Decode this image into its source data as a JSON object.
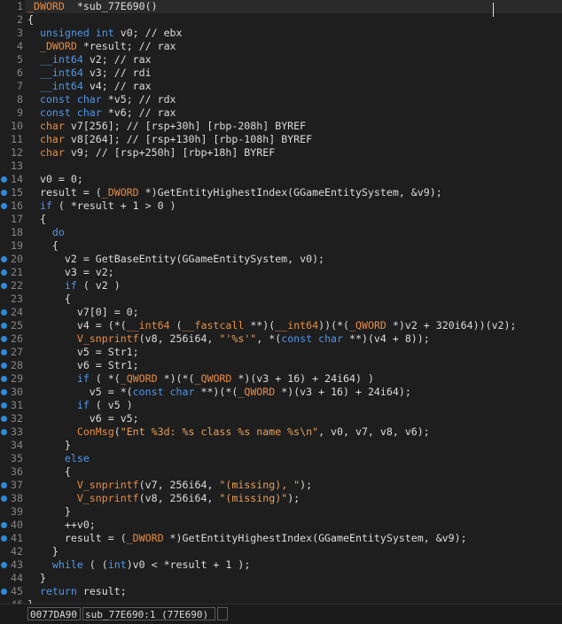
{
  "editor": {
    "lines": [
      {
        "n": "1",
        "bp": false,
        "tokens": [
          [
            "ty",
            "_DWORD"
          ],
          [
            "",
            "  *sub_77E690()"
          ]
        ]
      },
      {
        "n": "2",
        "bp": false,
        "tokens": [
          [
            "",
            "{"
          ]
        ]
      },
      {
        "n": "3",
        "bp": false,
        "tokens": [
          [
            "",
            "  "
          ],
          [
            "kw",
            "unsigned int"
          ],
          [
            "",
            " v0; // ebx"
          ]
        ]
      },
      {
        "n": "4",
        "bp": false,
        "tokens": [
          [
            "",
            "  "
          ],
          [
            "ty",
            "_DWORD"
          ],
          [
            "",
            " *result; // rax"
          ]
        ]
      },
      {
        "n": "5",
        "bp": false,
        "tokens": [
          [
            "",
            "  "
          ],
          [
            "kw",
            "__int64"
          ],
          [
            "",
            " v2; // rax"
          ]
        ]
      },
      {
        "n": "6",
        "bp": false,
        "tokens": [
          [
            "",
            "  "
          ],
          [
            "kw",
            "__int64"
          ],
          [
            "",
            " v3; // rdi"
          ]
        ]
      },
      {
        "n": "7",
        "bp": false,
        "tokens": [
          [
            "",
            "  "
          ],
          [
            "kw",
            "__int64"
          ],
          [
            "",
            " v4; // rax"
          ]
        ]
      },
      {
        "n": "8",
        "bp": false,
        "tokens": [
          [
            "",
            "  "
          ],
          [
            "kw",
            "const char"
          ],
          [
            "",
            " *v5; // rdx"
          ]
        ]
      },
      {
        "n": "9",
        "bp": false,
        "tokens": [
          [
            "",
            "  "
          ],
          [
            "kw",
            "const char"
          ],
          [
            "",
            " *v6; // rax"
          ]
        ]
      },
      {
        "n": "10",
        "bp": false,
        "tokens": [
          [
            "",
            "  "
          ],
          [
            "ty",
            "char"
          ],
          [
            "",
            " v7[256]; // [rsp+30h] [rbp-208h] BYREF"
          ]
        ]
      },
      {
        "n": "11",
        "bp": false,
        "tokens": [
          [
            "",
            "  "
          ],
          [
            "ty",
            "char"
          ],
          [
            "",
            " v8[264]; // [rsp+130h] [rbp-108h] BYREF"
          ]
        ]
      },
      {
        "n": "12",
        "bp": false,
        "tokens": [
          [
            "",
            "  "
          ],
          [
            "ty",
            "char"
          ],
          [
            "",
            " v9; // [rsp+250h] [rbp+18h] BYREF"
          ]
        ]
      },
      {
        "n": "13",
        "bp": false,
        "tokens": [
          [
            "",
            ""
          ]
        ]
      },
      {
        "n": "14",
        "bp": true,
        "tokens": [
          [
            "",
            "  v0 = 0;"
          ]
        ]
      },
      {
        "n": "15",
        "bp": true,
        "tokens": [
          [
            "",
            "  result = ("
          ],
          [
            "ty",
            "_DWORD"
          ],
          [
            "",
            " *)GetEntityHighestIndex(GGameEntitySystem, &v9);"
          ]
        ]
      },
      {
        "n": "16",
        "bp": true,
        "tokens": [
          [
            "",
            "  "
          ],
          [
            "kw",
            "if"
          ],
          [
            "",
            " ( *result + 1 > 0 )"
          ]
        ]
      },
      {
        "n": "17",
        "bp": false,
        "tokens": [
          [
            "",
            "  {"
          ]
        ]
      },
      {
        "n": "18",
        "bp": false,
        "tokens": [
          [
            "",
            "    "
          ],
          [
            "kw",
            "do"
          ]
        ]
      },
      {
        "n": "19",
        "bp": false,
        "tokens": [
          [
            "",
            "    {"
          ]
        ]
      },
      {
        "n": "20",
        "bp": true,
        "tokens": [
          [
            "",
            "      v2 = GetBaseEntity(GGameEntitySystem, v0);"
          ]
        ]
      },
      {
        "n": "21",
        "bp": true,
        "tokens": [
          [
            "",
            "      v3 = v2;"
          ]
        ]
      },
      {
        "n": "22",
        "bp": true,
        "tokens": [
          [
            "",
            "      "
          ],
          [
            "kw",
            "if"
          ],
          [
            "",
            " ( v2 )"
          ]
        ]
      },
      {
        "n": "23",
        "bp": false,
        "tokens": [
          [
            "",
            "      {"
          ]
        ]
      },
      {
        "n": "24",
        "bp": true,
        "tokens": [
          [
            "",
            "        v7[0] = 0;"
          ]
        ]
      },
      {
        "n": "25",
        "bp": true,
        "tokens": [
          [
            "",
            "        v4 = (*("
          ],
          [
            "ty",
            "__int64"
          ],
          [
            "",
            " ("
          ],
          [
            "ty",
            "__fastcall"
          ],
          [
            "",
            " **)("
          ],
          [
            "ty",
            "__int64"
          ],
          [
            "",
            "))(*("
          ],
          [
            "ty",
            "_QWORD"
          ],
          [
            "",
            " *)v2 + 320i64))(v2);"
          ]
        ]
      },
      {
        "n": "26",
        "bp": true,
        "tokens": [
          [
            "",
            "        "
          ],
          [
            "cg",
            "V_snprintf"
          ],
          [
            "",
            "(v8, 256i64, "
          ],
          [
            "str",
            "\"'%s'\""
          ],
          [
            "",
            ", *("
          ],
          [
            "kw",
            "const char"
          ],
          [
            "",
            " **)(v4 + 8));"
          ]
        ]
      },
      {
        "n": "27",
        "bp": true,
        "tokens": [
          [
            "",
            "        v5 = Str1;"
          ]
        ]
      },
      {
        "n": "28",
        "bp": true,
        "tokens": [
          [
            "",
            "        v6 = Str1;"
          ]
        ]
      },
      {
        "n": "29",
        "bp": true,
        "tokens": [
          [
            "",
            "        "
          ],
          [
            "kw",
            "if"
          ],
          [
            "",
            " ( *("
          ],
          [
            "ty",
            "_QWORD"
          ],
          [
            "",
            " *)(*("
          ],
          [
            "ty",
            "_QWORD"
          ],
          [
            "",
            " *)(v3 + 16) + 24i64) )"
          ]
        ]
      },
      {
        "n": "30",
        "bp": true,
        "tokens": [
          [
            "",
            "          v5 = *("
          ],
          [
            "kw",
            "const char"
          ],
          [
            "",
            " **)(*("
          ],
          [
            "ty",
            "_QWORD"
          ],
          [
            "",
            " *)(v3 + 16) + 24i64);"
          ]
        ]
      },
      {
        "n": "31",
        "bp": true,
        "tokens": [
          [
            "",
            "        "
          ],
          [
            "kw",
            "if"
          ],
          [
            "",
            " ( v5 )"
          ]
        ]
      },
      {
        "n": "32",
        "bp": true,
        "tokens": [
          [
            "",
            "          v6 = v5;"
          ]
        ]
      },
      {
        "n": "33",
        "bp": true,
        "tokens": [
          [
            "",
            "        "
          ],
          [
            "cg",
            "ConMsg"
          ],
          [
            "",
            "("
          ],
          [
            "str",
            "\"Ent %3d: %s class %s name %s\\n\""
          ],
          [
            "",
            ", v0, v7, v8, v6);"
          ]
        ]
      },
      {
        "n": "34",
        "bp": false,
        "tokens": [
          [
            "",
            "      }"
          ]
        ]
      },
      {
        "n": "35",
        "bp": false,
        "tokens": [
          [
            "",
            "      "
          ],
          [
            "kw",
            "else"
          ]
        ]
      },
      {
        "n": "36",
        "bp": false,
        "tokens": [
          [
            "",
            "      {"
          ]
        ]
      },
      {
        "n": "37",
        "bp": true,
        "tokens": [
          [
            "",
            "        "
          ],
          [
            "cg",
            "V_snprintf"
          ],
          [
            "",
            "(v7, 256i64, "
          ],
          [
            "str",
            "\"(missing), \""
          ],
          [
            "",
            ");"
          ]
        ]
      },
      {
        "n": "38",
        "bp": true,
        "tokens": [
          [
            "",
            "        "
          ],
          [
            "cg",
            "V_snprintf"
          ],
          [
            "",
            "(v8, 256i64, "
          ],
          [
            "str",
            "\"(missing)\""
          ],
          [
            "",
            ");"
          ]
        ]
      },
      {
        "n": "39",
        "bp": false,
        "tokens": [
          [
            "",
            "      }"
          ]
        ]
      },
      {
        "n": "40",
        "bp": true,
        "tokens": [
          [
            "",
            "      ++v0;"
          ]
        ]
      },
      {
        "n": "41",
        "bp": true,
        "tokens": [
          [
            "",
            "      result = ("
          ],
          [
            "ty",
            "_DWORD"
          ],
          [
            "",
            " *)GetEntityHighestIndex(GGameEntitySystem, &v9);"
          ]
        ]
      },
      {
        "n": "42",
        "bp": false,
        "tokens": [
          [
            "",
            "    }"
          ]
        ]
      },
      {
        "n": "43",
        "bp": true,
        "tokens": [
          [
            "",
            "    "
          ],
          [
            "kw",
            "while"
          ],
          [
            "",
            " ( ("
          ],
          [
            "kw",
            "int"
          ],
          [
            "",
            ")v0 < *result + 1 );"
          ]
        ]
      },
      {
        "n": "44",
        "bp": false,
        "tokens": [
          [
            "",
            "  }"
          ]
        ]
      },
      {
        "n": "45",
        "bp": true,
        "tokens": [
          [
            "",
            "  "
          ],
          [
            "kw",
            "return"
          ],
          [
            "",
            " result;"
          ]
        ]
      },
      {
        "n": "46",
        "bp": false,
        "tokens": [
          [
            "",
            "}"
          ]
        ]
      }
    ]
  },
  "statusbar": {
    "address": "0077DA90",
    "location": "sub_77E690:1 (77E690)",
    "extra": ""
  },
  "colors": {
    "background": "#1e1e1e",
    "keyword": "#4f96e8",
    "type": "#e78c45",
    "string": "#e7a05a",
    "breakpoint_dot": "#2f8ad9"
  }
}
